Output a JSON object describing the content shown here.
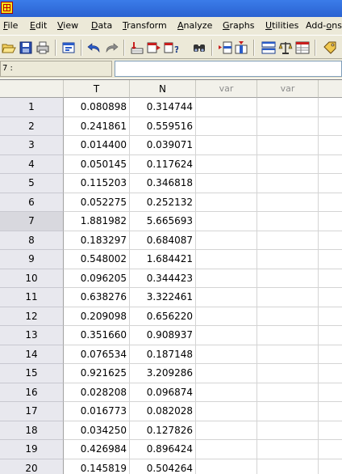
{
  "menubar": {
    "items": [
      "File",
      "Edit",
      "View",
      "Data",
      "Transform",
      "Analyze",
      "Graphs",
      "Utilities",
      "Add-ons"
    ],
    "underline_index": [
      0,
      0,
      0,
      0,
      0,
      0,
      0,
      0,
      4
    ]
  },
  "editor": {
    "cell_ref": "7 :",
    "value": ""
  },
  "grid": {
    "columns": [
      "T",
      "N",
      "var",
      "var"
    ],
    "rows": [
      {
        "num": "1",
        "t": "0.080898",
        "n": "0.314744"
      },
      {
        "num": "2",
        "t": "0.241861",
        "n": "0.559516"
      },
      {
        "num": "3",
        "t": "0.014400",
        "n": "0.039071"
      },
      {
        "num": "4",
        "t": "0.050145",
        "n": "0.117624"
      },
      {
        "num": "5",
        "t": "0.115203",
        "n": "0.346818"
      },
      {
        "num": "6",
        "t": "0.052275",
        "n": "0.252132"
      },
      {
        "num": "7",
        "t": "1.881982",
        "n": "5.665693"
      },
      {
        "num": "8",
        "t": "0.183297",
        "n": "0.684087"
      },
      {
        "num": "9",
        "t": "0.548002",
        "n": "1.684421"
      },
      {
        "num": "10",
        "t": "0.096205",
        "n": "0.344423"
      },
      {
        "num": "11",
        "t": "0.638276",
        "n": "3.322461"
      },
      {
        "num": "12",
        "t": "0.209098",
        "n": "0.656220"
      },
      {
        "num": "13",
        "t": "0.351660",
        "n": "0.908937"
      },
      {
        "num": "14",
        "t": "0.076534",
        "n": "0.187148"
      },
      {
        "num": "15",
        "t": "0.921625",
        "n": "3.209286"
      },
      {
        "num": "16",
        "t": "0.028208",
        "n": "0.096874"
      },
      {
        "num": "17",
        "t": "0.016773",
        "n": "0.082028"
      },
      {
        "num": "18",
        "t": "0.034250",
        "n": "0.127826"
      },
      {
        "num": "19",
        "t": "0.426984",
        "n": "0.896424"
      },
      {
        "num": "20",
        "t": "0.145819",
        "n": "0.504264"
      }
    ],
    "selected_row": "7"
  },
  "colors": {
    "titlebar": "#2a62d1",
    "chrome": "#ece9d8",
    "row_header": "#e8e8ee",
    "var_header_text": "#8c8c8c"
  },
  "icons": [
    "open-icon",
    "save-icon",
    "print-icon",
    "dialog-recall-icon",
    "undo-icon",
    "redo-icon",
    "goto-case-icon",
    "variables-icon",
    "find-icon",
    "insert-cases-icon",
    "insert-variable-icon",
    "split-file-icon",
    "weight-cases-icon",
    "select-cases-icon",
    "value-labels-icon"
  ]
}
